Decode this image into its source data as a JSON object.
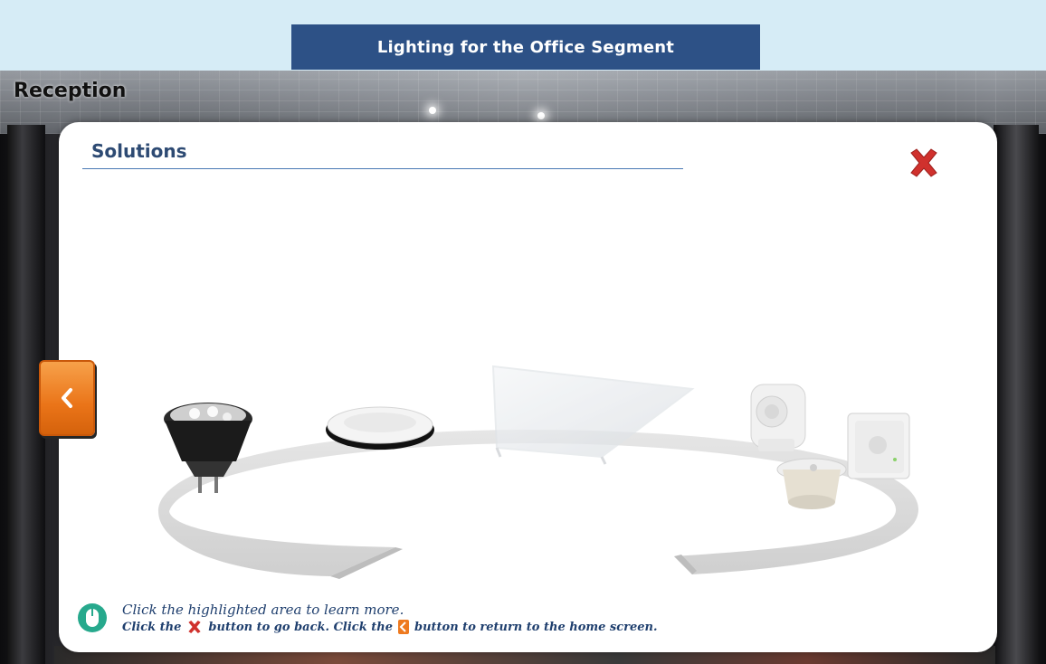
{
  "header": {
    "title": "Lighting for the Office Segment"
  },
  "section": {
    "title": "Reception"
  },
  "panel": {
    "title": "Solutions",
    "close_icon": "close-x-icon",
    "back_icon": "chevron-left-icon"
  },
  "products": [
    {
      "name": "led-spot-lamp"
    },
    {
      "name": "downlight"
    },
    {
      "name": "panel-luminaire"
    },
    {
      "name": "motion-sensor"
    },
    {
      "name": "wall-sensor-box"
    },
    {
      "name": "ceiling-sensor"
    }
  ],
  "instructions": {
    "line1": "Click the highlighted area to learn more.",
    "line2_part1": "Click the",
    "line2_part2": "button to go back. Click the",
    "line2_part3": "button to return to the home screen."
  },
  "colors": {
    "header_band": "#d6ecf6",
    "title_box": "#2d5186",
    "panel_title": "#2d4a73",
    "close_red": "#d0312d",
    "back_orange": "#ea7418",
    "instruction_text": "#1f3f6e"
  }
}
